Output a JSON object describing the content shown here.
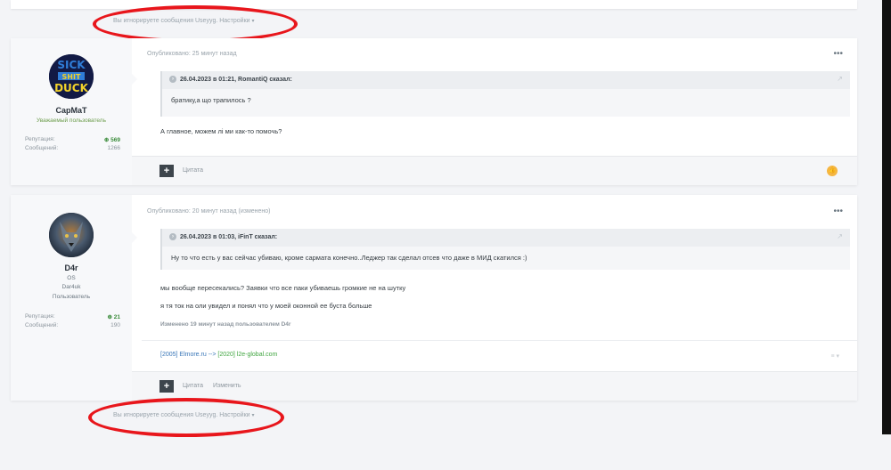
{
  "ignored_top": {
    "text": "Вы игнорируете сообщения Useyyg. Настройки",
    "caret": "▾"
  },
  "ignored_bottom": {
    "text": "Вы игнорируете сообщения Useyyg. Настройки",
    "caret": "▾"
  },
  "post1": {
    "author": {
      "name": "CapMaT",
      "title": "Уважаемый пользователь",
      "avatar_text": "SICK ☰ DUCK"
    },
    "stats": [
      {
        "label": "Репутация:",
        "value": "569",
        "icon": "plus-circle-icon"
      },
      {
        "label": "Сообщений:",
        "value": "1266"
      }
    ],
    "meta": "Опубликовано: 25 минут назад",
    "dots": "•••",
    "quote": {
      "head": "26.04.2023 в 01:21, RomantiQ сказал:",
      "body": "братику,а що трапилось ?"
    },
    "text": "А главное, можем лі ми как-то помочь?",
    "footer": {
      "plus": "+",
      "quote_label": "Цитата",
      "like_icon": "thumbs-up-icon"
    }
  },
  "post2": {
    "author": {
      "name": "D4r",
      "line1": "OS",
      "line2": "Dar4uk",
      "title": "Пользователь"
    },
    "stats": [
      {
        "label": "Репутация:",
        "value": "21",
        "icon": "plus-circle-icon"
      },
      {
        "label": "Сообщений:",
        "value": "190"
      }
    ],
    "meta": "Опубликовано: 20 минут назад (изменено)",
    "dots": "•••",
    "quote": {
      "head": "26.04.2023 в 01:03, iFinT сказал:",
      "body": "Ну то что есть у вас сейчас убиваю, кроме сармата конечно..Леджер так сделал отсев что даже в МИД скатился :)"
    },
    "text1": "мы вообще пересекались? Заявки что все паки убиваешь громкие не на шутку",
    "text2": "я тя ток на оли увидел и понял что у моей оконной ее буста больше",
    "edited": "Изменено 19 минут назад пользователем D4r",
    "signature": {
      "part1": "[2005] Elmore.ru --> ",
      "part2": "[2020] l2e-global.com"
    },
    "sig_caret": "≡ ▾",
    "footer": {
      "plus": "+",
      "quote_label": "Цитата",
      "edit_label": "Изменить"
    }
  }
}
